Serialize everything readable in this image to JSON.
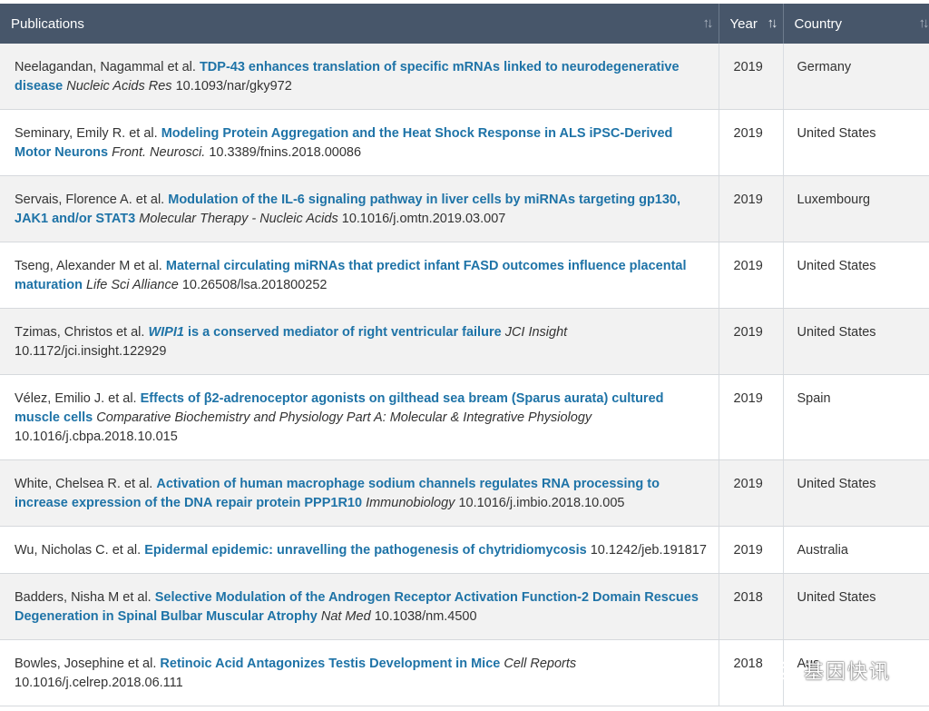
{
  "table": {
    "headers": {
      "publications": "Publications",
      "year": "Year",
      "country": "Country"
    },
    "rows": [
      {
        "authors": "Neelagandan, Nagammal et al.",
        "title": "TDP-43 enhances translation of specific mRNAs linked to neurodegenerative disease",
        "journal": "Nucleic Acids Res",
        "doi": "10.1093/nar/gky972",
        "year": "2019",
        "country": "Germany"
      },
      {
        "authors": "Seminary, Emily R. et al.",
        "title": "Modeling Protein Aggregation and the Heat Shock Response in ALS iPSC-Derived Motor Neurons",
        "journal": "Front. Neurosci.",
        "doi": "10.3389/fnins.2018.00086",
        "year": "2019",
        "country": "United States"
      },
      {
        "authors": "Servais, Florence A. et al.",
        "title": "Modulation of the IL-6 signaling pathway in liver cells by miRNAs targeting gp130, JAK1 and/or STAT3",
        "journal": "Molecular Therapy - Nucleic Acids",
        "doi": "10.1016/j.omtn.2019.03.007",
        "year": "2019",
        "country": "Luxembourg"
      },
      {
        "authors": "Tseng, Alexander M et al.",
        "title": "Maternal circulating miRNAs that predict infant FASD outcomes influence placental maturation",
        "journal": "Life Sci Alliance",
        "doi": "10.26508/lsa.201800252",
        "year": "2019",
        "country": "United States"
      },
      {
        "authors": "Tzimas, Christos et al.",
        "title_italic": "WIPI1",
        "title": " is a conserved mediator of right ventricular failure",
        "journal": "JCI Insight",
        "doi": "10.1172/jci.insight.122929",
        "year": "2019",
        "country": "United States"
      },
      {
        "authors": "Vélez, Emilio J. et al.",
        "title": "Effects of β2-adrenoceptor agonists on gilthead sea bream (Sparus aurata) cultured muscle cells",
        "journal": "Comparative Biochemistry and Physiology Part A: Molecular & Integrative Physiology",
        "doi": "10.1016/j.cbpa.2018.10.015",
        "year": "2019",
        "country": "Spain"
      },
      {
        "authors": "White, Chelsea R. et al.",
        "title": "Activation of human macrophage sodium channels regulates RNA processing to increase expression of the DNA repair protein PPP1R10",
        "journal": "Immunobiology",
        "doi": "10.1016/j.imbio.2018.10.005",
        "year": "2019",
        "country": "United States"
      },
      {
        "authors": "Wu, Nicholas C. et al.",
        "title": "Epidermal epidemic: unravelling the pathogenesis of chytridiomycosis",
        "journal": "",
        "doi": "10.1242/jeb.191817",
        "year": "2019",
        "country": "Australia"
      },
      {
        "authors": "Badders, Nisha M et al.",
        "title": "Selective Modulation of the Androgen Receptor Activation Function-2 Domain Rescues Degeneration in Spinal Bulbar Muscular Atrophy",
        "journal": "Nat Med",
        "doi": "10.1038/nm.4500",
        "year": "2018",
        "country": "United States"
      },
      {
        "authors": "Bowles, Josephine et al.",
        "title": "Retinoic Acid Antagonizes Testis Development in Mice",
        "journal": "Cell Reports",
        "doi": "10.1016/j.celrep.2018.06.111",
        "year": "2018",
        "country": "Aus"
      }
    ]
  },
  "watermark": {
    "text": "基因快讯",
    "icon": "wechat-icon"
  },
  "colors": {
    "header_bg": "#47566a",
    "link": "#1e73a7",
    "row_alt": "#f2f2f2"
  }
}
